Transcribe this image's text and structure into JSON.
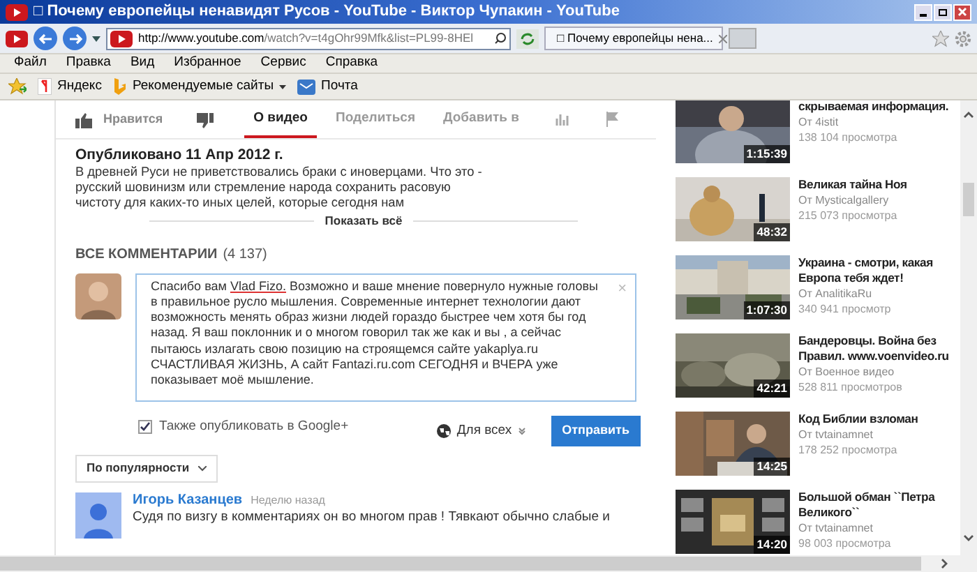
{
  "window": {
    "title": "□ Почему европейцы ненавидят Русов - YouTube - Виктор Чупакин - YouTube"
  },
  "browser": {
    "url_host": "http://www.youtube.com",
    "url_path": "/watch?v=t4gOhr99Mfk&list=PL99-8HEl",
    "tab": {
      "title": "□ Почему европейцы нена...",
      "selected": true
    },
    "menu": [
      "Файл",
      "Правка",
      "Вид",
      "Избранное",
      "Сервис",
      "Справка"
    ],
    "favorites": [
      {
        "label": "Яндекс",
        "kind": "yandex",
        "dropdown": false
      },
      {
        "label": "Рекомендуемые сайты",
        "kind": "bing",
        "dropdown": true
      },
      {
        "label": "Почта",
        "kind": "mail",
        "dropdown": false
      }
    ]
  },
  "video": {
    "like": "Нравится",
    "tabs": [
      {
        "kind": "text",
        "label": "О видео",
        "selected": true
      },
      {
        "kind": "text",
        "label": "Поделиться",
        "selected": false
      },
      {
        "kind": "text",
        "label": "Добавить в",
        "selected": false
      },
      {
        "kind": "stats",
        "selected": false
      },
      {
        "kind": "flag",
        "selected": false
      }
    ],
    "published": "Опубликовано 11 Апр 2012 г.",
    "description": "В древней Руси не приветствовались браки с иноверцами. Что это - русский шовинизм или стремление народа сохранить расовую чистоту для каких-то иных целей, которые сегодня нам",
    "show_all": "Показать всё"
  },
  "comments": {
    "heading": "ВСЕ КОММЕНТАРИИ",
    "count": "(4 137)",
    "composer": {
      "segments": [
        {
          "text": "Спасибо вам ",
          "misspelled": false
        },
        {
          "text": "Vlad Fizo.",
          "misspelled": true
        },
        {
          "text": " Возможно и ваше мнение повернуло нужные головы в правильное русло мышления.  Современные интернет технологии дают возможность  менять образ жизни людей гораздо быстрее чем хотя бы год назад. Я ваш поклонник и о многом говорил так же как и вы , а сейчас пытаюсь излагать свою позицию на строящемся сайте yakaplya.ru  СЧАСТЛИВАЯ ЖИЗНЬ, А сайт  Fantazi.ru.com  СЕГОДНЯ и ВЧЕРА  уже показывает моё мышление.",
          "misspelled": false
        }
      ],
      "close": "×",
      "share": {
        "label": "Также опубликовать в Google+",
        "checked": true
      },
      "privacy": "Для всех",
      "submit": "Отправить"
    },
    "sort": "По популярности",
    "items": [
      {
        "author": "Игорь Казанцев",
        "time": "Неделю назад",
        "text": "Судя по визгу в комментариях он во многом прав ! Тявкают обычно слабые и"
      }
    ]
  },
  "related": [
    {
      "title": "скрываемая информация.",
      "channel": "От 4istit",
      "views": "138 104 просмотра",
      "duration": "1:15:39"
    },
    {
      "title": "Великая тайна Ноя",
      "channel": "От Mysticalgallery",
      "views": "215 073 просмотра",
      "duration": "48:32"
    },
    {
      "title": "Украина - смотри, какая Европа тебя ждет!",
      "channel": "От AnalitikaRu",
      "views": "340 941 просмотр",
      "duration": "1:07:30"
    },
    {
      "title": "Бандеровцы. Война без Правил. www.voenvideo.ru",
      "channel": "От Военное видео",
      "views": "528 811 просмотров",
      "duration": "42:21"
    },
    {
      "title": "Код Библии взломан",
      "channel": "От tvtainamnet",
      "views": "178 252 просмотра",
      "duration": "14:25"
    },
    {
      "title": "Большой обман ``Петра Великого``",
      "channel": "От tvtainamnet",
      "views": "98 003 просмотра",
      "duration": "14:20"
    }
  ]
}
